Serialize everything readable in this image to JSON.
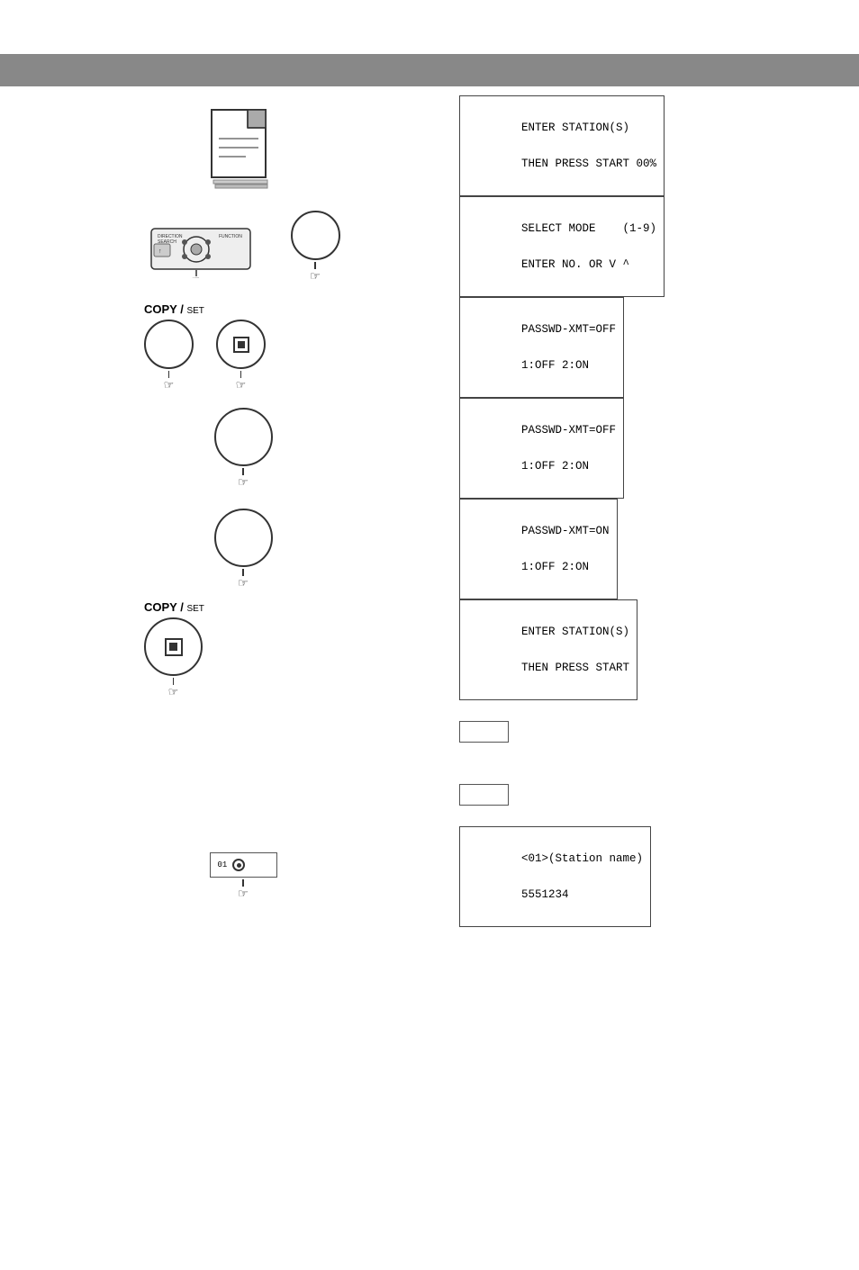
{
  "header": {
    "background": "#888888"
  },
  "sections": [
    {
      "id": "section1",
      "icon_type": "document",
      "lcd": {
        "line1": "ENTER STATION(S)",
        "line2": "THEN PRESS START 00%"
      }
    },
    {
      "id": "section2",
      "icon_type": "control_panel_with_circle",
      "lcd": {
        "line1": "SELECT MODE    (1-9)",
        "line2": "ENTER NO. OR V ^"
      }
    },
    {
      "id": "section3",
      "icon_type": "copy_set_circle_square",
      "label": "COPY / SET",
      "lcd": {
        "line1": "PASSWD-XMT=OFF",
        "line2": "1:OFF 2:ON"
      }
    },
    {
      "id": "section4",
      "icon_type": "circle_only",
      "lcd": {
        "line1": "PASSWD-XMT=OFF",
        "line2": "1:OFF 2:ON"
      }
    },
    {
      "id": "section5",
      "icon_type": "circle_only",
      "lcd": {
        "line1": "PASSWD-XMT=ON",
        "line2": "1:OFF 2:ON"
      }
    },
    {
      "id": "section6",
      "icon_type": "copy_set_square_only",
      "label": "COPY / SET",
      "lcd": {
        "line1": "ENTER STATION(S)",
        "line2": "THEN PRESS START"
      }
    },
    {
      "id": "section7",
      "icon_type": "small_rects",
      "lcd": null
    },
    {
      "id": "section8",
      "icon_type": "small_rect2",
      "lcd": null
    },
    {
      "id": "section9",
      "icon_type": "station_dial",
      "lcd": {
        "line1": "<01>(Station name)",
        "line2": "5551234"
      }
    }
  ],
  "labels": {
    "copy_set": "COPY /",
    "set_sub": "SET"
  }
}
